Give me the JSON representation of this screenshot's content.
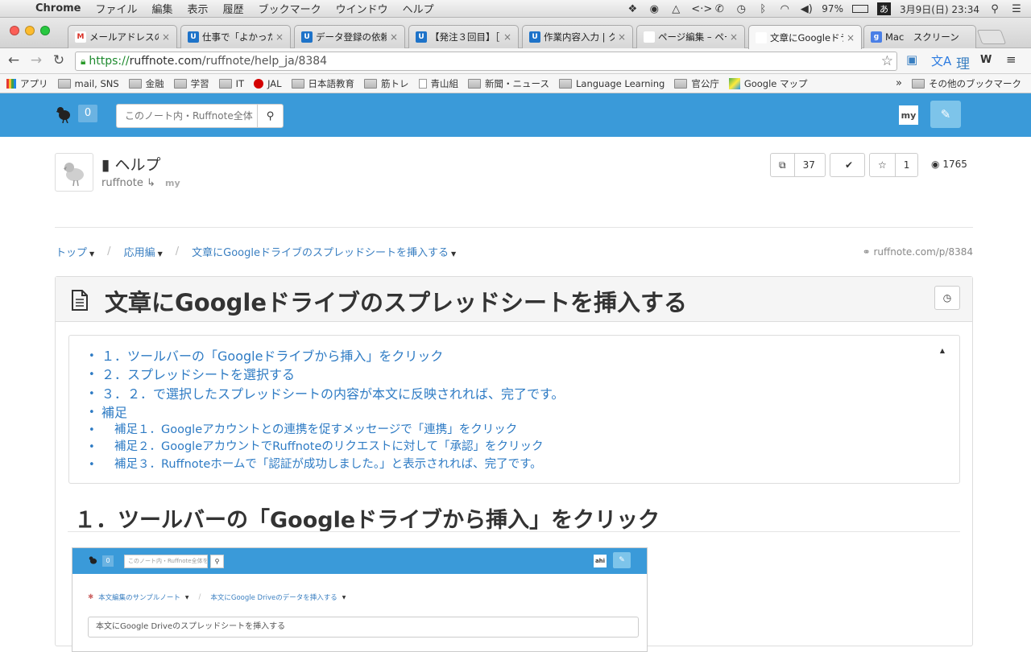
{
  "menubar": {
    "app": "Chrome",
    "items": [
      "ファイル",
      "編集",
      "表示",
      "履歴",
      "ブックマーク",
      "ウインドウ",
      "ヘルプ"
    ],
    "battery": "97%",
    "ime": "あ",
    "datetime": "3月9日(日)  23:34"
  },
  "tabs": [
    {
      "label": "メールアドレスの",
      "favicon": "gmail-icon",
      "fav_text": "M",
      "fav_color": "#ffffff",
      "fav_fg": "#d93025"
    },
    {
      "label": "仕事で「よかった",
      "favicon": "u-app-icon",
      "fav_text": "U",
      "fav_color": "#1e73c9",
      "fav_fg": "#ffffff"
    },
    {
      "label": "データ登録の依頼",
      "favicon": "u-app-icon",
      "fav_text": "U",
      "fav_color": "#1e73c9",
      "fav_fg": "#ffffff"
    },
    {
      "label": "【発注３回目】［",
      "favicon": "u-app-icon",
      "fav_text": "U",
      "fav_color": "#1e73c9",
      "fav_fg": "#ffffff"
    },
    {
      "label": "作業内容入力 | ク",
      "favicon": "u-app-icon",
      "fav_text": "U",
      "fav_color": "#1e73c9",
      "fav_fg": "#ffffff"
    },
    {
      "label": "ページ編集 – ペー",
      "favicon": "ruffnote-icon",
      "fav_text": "",
      "fav_color": "#ffffff",
      "fav_fg": "#333333"
    },
    {
      "label": "文章にGoogleドラ",
      "favicon": "ruffnote-icon",
      "fav_text": "",
      "fav_color": "#ffffff",
      "fav_fg": "#333333"
    },
    {
      "label": "Mac　スクリーン",
      "favicon": "google-icon",
      "fav_text": "g",
      "fav_color": "#4a7fe6",
      "fav_fg": "#ffffff"
    }
  ],
  "url": {
    "scheme": "https://",
    "host": "ruffnote.com",
    "path": "/ruffnote/help_ja/8384"
  },
  "bookmarks": [
    {
      "label": "アプリ",
      "icon": "apps-grid-icon"
    },
    {
      "label": "mail, SNS",
      "icon": "folder-icon"
    },
    {
      "label": "金融",
      "icon": "folder-icon"
    },
    {
      "label": "学習",
      "icon": "folder-icon"
    },
    {
      "label": "IT",
      "icon": "folder-icon"
    },
    {
      "label": "JAL",
      "icon": "jal-icon"
    },
    {
      "label": "日本語教育",
      "icon": "folder-icon"
    },
    {
      "label": "筋トレ",
      "icon": "folder-icon"
    },
    {
      "label": "青山組",
      "icon": "page-icon"
    },
    {
      "label": "新聞・ニュース",
      "icon": "folder-icon"
    },
    {
      "label": "Language Learning",
      "icon": "folder-icon"
    },
    {
      "label": "官公庁",
      "icon": "folder-icon"
    },
    {
      "label": "Google マップ",
      "icon": "maps-icon"
    }
  ],
  "bookmarks_more": "»",
  "bookmarks_other": "その他のブックマーク",
  "ext_ri": "理",
  "ext_w": "W",
  "site": {
    "count": "0",
    "search_placeholder": "このノート内・Ruffnote全体",
    "my_avatar": "my",
    "brand_color": "#3a9ad9"
  },
  "note": {
    "title": "ヘルプ",
    "owner": "ruffnote",
    "owner_arrow": "↳",
    "owner_badge": "my",
    "stats": {
      "copies": "37",
      "checks": "1",
      "stars": "1",
      "views": "1765"
    }
  },
  "breadcrumb": [
    "トップ",
    "応用編",
    "文章にGoogleドライブのスプレッドシートを挿入する"
  ],
  "short_url": "ruffnote.com/p/8384",
  "page_title": "文章にGoogleドライブのスプレッドシートを挿入する",
  "toc": [
    "１．ツールバーの「Googleドライブから挿入」をクリック",
    "２．スプレッドシートを選択する",
    "３．２．で選択したスプレッドシートの内容が本文に反映されれば、完了です。",
    "補足"
  ],
  "toc_sub": [
    "補足１．Googleアカウントとの連携を促すメッセージで「連携」をクリック",
    "補足２．GoogleアカウントでRuffnoteのリクエストに対して「承認」をクリック",
    "補足３．Ruffnoteホームで「認証が成功しました。」と表示されれば、完了です。"
  ],
  "section_heading": "１．ツールバーの「Googleドライブから挿入」をクリック",
  "screenshot": {
    "count": "0",
    "search_placeholder": "このノート内・Ruffnote全体を検",
    "avatar": "ahi",
    "crumb1": "本文編集のサンプルノート",
    "crumb2": "本文にGoogle Driveのデータを挿入する",
    "input_value": "本文にGoogle Driveのスプレッドシートを挿入する"
  }
}
